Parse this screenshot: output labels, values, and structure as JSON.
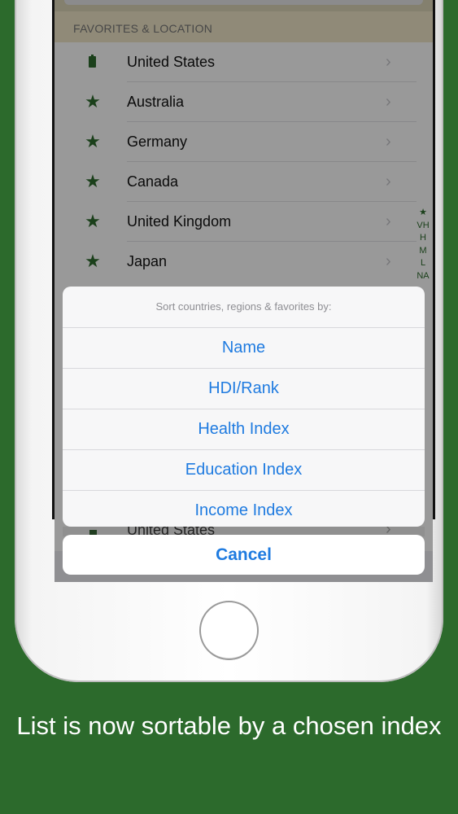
{
  "section_header": "FAVORITES & LOCATION",
  "rows": [
    {
      "icon": "location-icon",
      "label": "United States"
    },
    {
      "icon": "star-icon",
      "label": "Australia"
    },
    {
      "icon": "star-icon",
      "label": "Germany"
    },
    {
      "icon": "star-icon",
      "label": "Canada"
    },
    {
      "icon": "star-icon",
      "label": "United Kingdom"
    },
    {
      "icon": "star-icon",
      "label": "Japan"
    }
  ],
  "index_bar": [
    "★",
    "VH",
    "H",
    "M",
    "L",
    "NA"
  ],
  "action_sheet": {
    "title": "Sort countries, regions & favorites by:",
    "options": [
      "Name",
      "HDI/Rank",
      "Health Index",
      "Education Index",
      "Income Index"
    ],
    "cancel_label": "Cancel"
  },
  "behind_row_label": "United States",
  "caption": "List is now sortable by a chosen index",
  "colors": {
    "background": "#2c6a2c",
    "accent_blue": "#1f7be0",
    "icon_green": "#2e6b2e",
    "section_header_bg": "#f1e7c9"
  }
}
